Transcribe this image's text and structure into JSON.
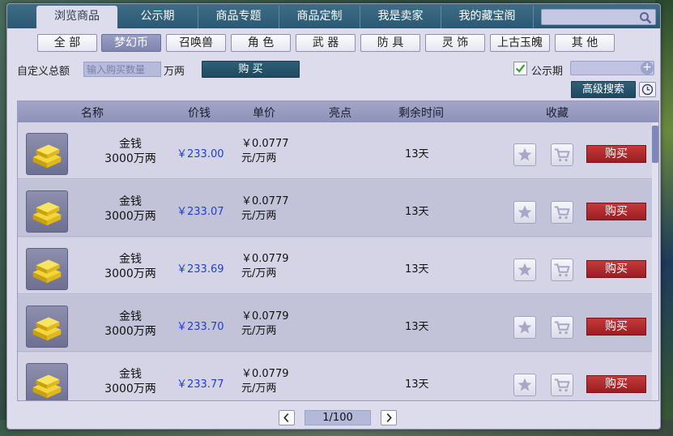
{
  "tabs": [
    {
      "label": "浏览商品",
      "active": true
    },
    {
      "label": "公示期",
      "active": false
    },
    {
      "label": "商品专题",
      "active": false
    },
    {
      "label": "商品定制",
      "active": false
    },
    {
      "label": "我是卖家",
      "active": false
    },
    {
      "label": "我的藏宝阁",
      "active": false
    }
  ],
  "search": {
    "placeholder": "",
    "icon": "search-icon"
  },
  "categories": [
    {
      "label": "全 部",
      "active": false
    },
    {
      "label": "梦幻币",
      "active": true
    },
    {
      "label": "召唤兽",
      "active": false
    },
    {
      "label": "角 色",
      "active": false
    },
    {
      "label": "武 器",
      "active": false
    },
    {
      "label": "防 具",
      "active": false
    },
    {
      "label": "灵 饰",
      "active": false
    },
    {
      "label": "上古玉魄",
      "active": false
    },
    {
      "label": "其 他",
      "active": false
    }
  ],
  "custom": {
    "label": "自定义总额",
    "placeholder": "输入购买数量",
    "unit": "万两",
    "buy_label": "购 买"
  },
  "filter": {
    "period_label": "公示期",
    "period_checked": true,
    "advanced_label": "高级搜索"
  },
  "table": {
    "headers": [
      "名称",
      "价钱",
      "单价",
      "亮点",
      "剩余时间",
      "收藏"
    ],
    "rows": [
      {
        "name1": "金钱",
        "name2": "3000万两",
        "price": "￥233.00",
        "unit1": "￥0.0777",
        "unit2": "元/万两",
        "remain": "13天",
        "buy": "购买"
      },
      {
        "name1": "金钱",
        "name2": "3000万两",
        "price": "￥233.07",
        "unit1": "￥0.0777",
        "unit2": "元/万两",
        "remain": "13天",
        "buy": "购买"
      },
      {
        "name1": "金钱",
        "name2": "3000万两",
        "price": "￥233.69",
        "unit1": "￥0.0779",
        "unit2": "元/万两",
        "remain": "13天",
        "buy": "购买"
      },
      {
        "name1": "金钱",
        "name2": "3000万两",
        "price": "￥233.70",
        "unit1": "￥0.0779",
        "unit2": "元/万两",
        "remain": "13天",
        "buy": "购买"
      },
      {
        "name1": "金钱",
        "name2": "3000万两",
        "price": "￥233.77",
        "unit1": "￥0.0779",
        "unit2": "元/万两",
        "remain": "13天",
        "buy": "购买"
      }
    ]
  },
  "pager": {
    "text": "1/100"
  },
  "colors": {
    "accent": "#2b5873",
    "buy": "#b02a2e",
    "price": "#2040c8"
  }
}
